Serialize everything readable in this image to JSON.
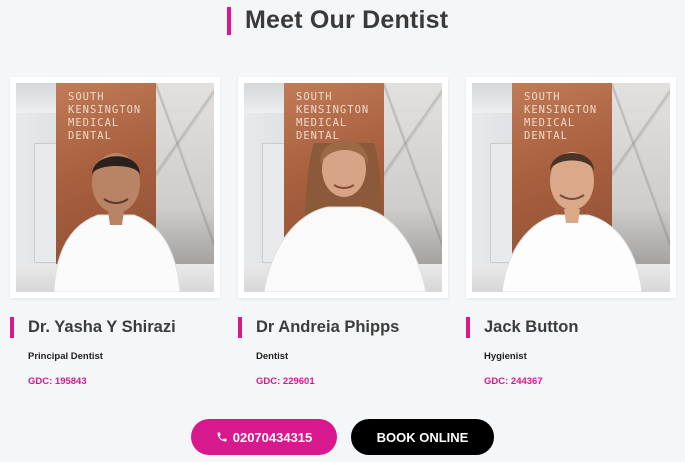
{
  "section": {
    "title": "Meet Our Dentist"
  },
  "sign_lines": [
    "SOUTH",
    "KENSINGTON",
    "MEDICAL",
    "DENTAL"
  ],
  "dentists": [
    {
      "name": "Dr. Yasha Y Shirazi",
      "role": "Principal Dentist",
      "gdc": "GDC: 195843"
    },
    {
      "name": "Dr Andreia Phipps",
      "role": "Dentist",
      "gdc": "GDC: 229601"
    },
    {
      "name": "Jack Button",
      "role": "Hygienist",
      "gdc": "GDC: 244367"
    }
  ],
  "actions": {
    "phone_label": "02070434315",
    "phone_icon": "phone-icon",
    "book_label": "BOOK ONLINE"
  },
  "colors": {
    "accent": "#d8198e",
    "book_bg": "#000000",
    "page_bg": "#f5f6f8"
  }
}
